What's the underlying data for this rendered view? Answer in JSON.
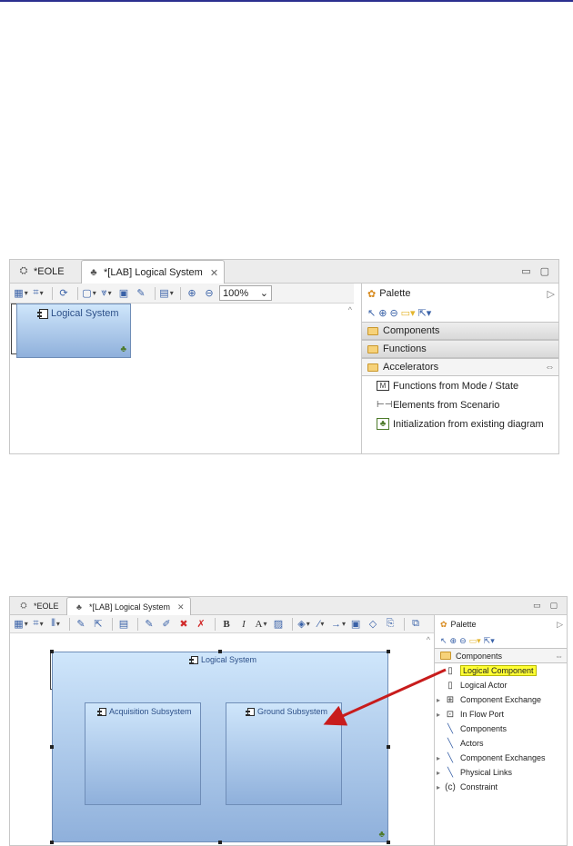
{
  "top": {
    "tabs": [
      {
        "label": "*EOLE",
        "icon": "eole-icon"
      },
      {
        "label": "*[LAB] Logical System",
        "icon": "diagram-icon"
      }
    ],
    "zoom": "100%",
    "component": "Logical System",
    "palette": {
      "title": "Palette",
      "drawers": [
        "Components",
        "Functions",
        "Accelerators"
      ],
      "items": [
        "Functions from Mode / State",
        "Elements from Scenario",
        "Initialization from existing diagram"
      ]
    }
  },
  "bottom": {
    "tabs": [
      {
        "label": "*EOLE",
        "icon": "eole-icon"
      },
      {
        "label": "*[LAB] Logical System",
        "icon": "diagram-icon"
      }
    ],
    "root": "Logical System",
    "subsystems": [
      "Acquisition Subsystem",
      "Ground Subsystem"
    ],
    "palette": {
      "title": "Palette",
      "drawer": "Components",
      "items": [
        {
          "label": "Logical Component",
          "highlight": true,
          "icon": "component-icon"
        },
        {
          "label": "Logical Actor",
          "icon": "actor-icon"
        },
        {
          "label": "Component Exchange",
          "expandable": true,
          "icon": "exchange-icon"
        },
        {
          "label": "In Flow Port",
          "expandable": true,
          "icon": "port-icon"
        },
        {
          "label": "Components",
          "icon": "link-icon"
        },
        {
          "label": "Actors",
          "icon": "link-icon"
        },
        {
          "label": "Component Exchanges",
          "expandable": true,
          "icon": "link-icon"
        },
        {
          "label": "Physical Links",
          "expandable": true,
          "icon": "link-icon"
        },
        {
          "label": "Constraint",
          "expandable": true,
          "icon": "constraint-icon"
        }
      ]
    }
  },
  "colors": {
    "highlight": "#ffff33",
    "arrow": "#c81c1c",
    "component_top": "#cfe6fb",
    "component_bottom": "#8fb0db"
  }
}
